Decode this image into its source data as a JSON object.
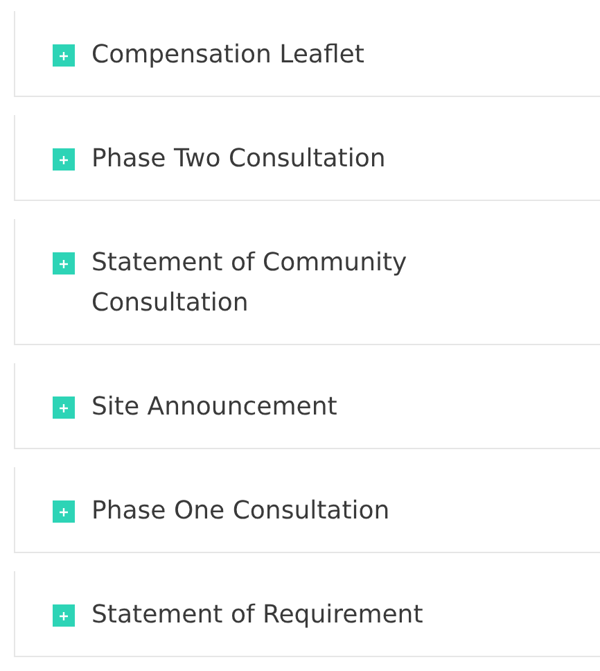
{
  "items": [
    {
      "title": "Compensation Leaflet",
      "expanded": false
    },
    {
      "title": "Phase Two Consultation",
      "expanded": false
    },
    {
      "title": "Statement of Community Consultation",
      "expanded": false
    },
    {
      "title": "Site Announcement",
      "expanded": false
    },
    {
      "title": "Phase One Consultation",
      "expanded": false
    },
    {
      "title": "Statement of Requirement",
      "expanded": false
    }
  ]
}
